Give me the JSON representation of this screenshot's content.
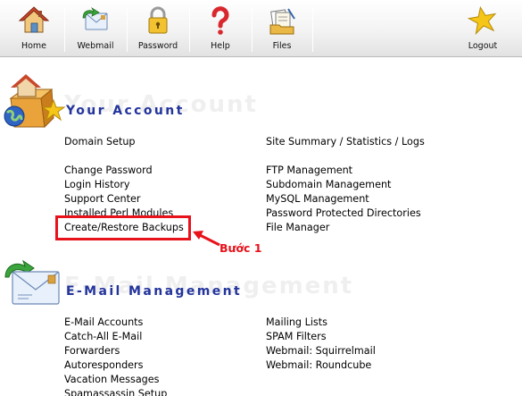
{
  "toolbar": {
    "items": [
      {
        "label": "Home",
        "icon": "house-icon"
      },
      {
        "label": "Webmail",
        "icon": "mail-icon"
      },
      {
        "label": "Password",
        "icon": "padlock-icon"
      },
      {
        "label": "Help",
        "icon": "question-mark-icon"
      },
      {
        "label": "Files",
        "icon": "files-folder-icon"
      },
      {
        "label": "Logout",
        "icon": "star-icon"
      }
    ]
  },
  "account": {
    "title": "Your Account",
    "left": [
      "Domain Setup",
      "Change Password",
      "Login History",
      "Support Center",
      "Installed Perl Modules",
      "Create/Restore Backups"
    ],
    "right": [
      "Site Summary / Statistics / Logs",
      "FTP Management",
      "Subdomain Management",
      "MySQL Management",
      "Password Protected Directories",
      "File Manager"
    ]
  },
  "email": {
    "title": "E-Mail Management",
    "left": [
      "E-Mail Accounts",
      "Catch-All E-Mail",
      "Forwarders",
      "Autoresponders",
      "Vacation Messages",
      "Spamassassin Setup"
    ],
    "right": [
      "Mailing Lists",
      "SPAM Filters",
      "Webmail: Squirrelmail",
      "Webmail: Roundcube"
    ]
  },
  "annotation": {
    "step": "Bước 1",
    "color": "#e8121b"
  },
  "colors": {
    "title": "#23349c",
    "ghost": "#efefef"
  }
}
